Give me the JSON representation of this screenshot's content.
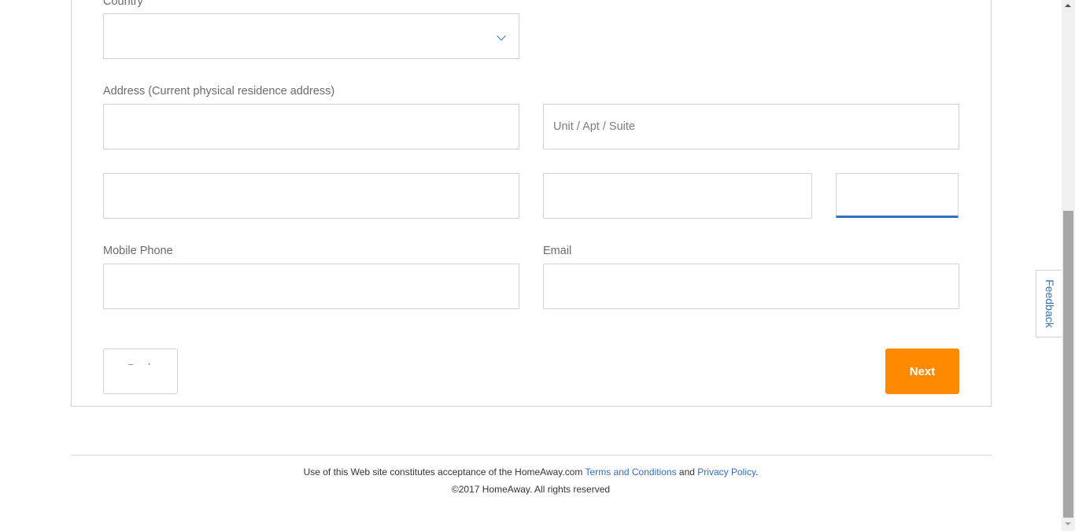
{
  "form": {
    "country": {
      "label": "Country",
      "selected_value": ""
    },
    "address": {
      "label": "Address (Current physical residence address)",
      "street_value": "",
      "unit_placeholder": "Unit / Apt / Suite",
      "unit_value": "",
      "city_value": "",
      "state_value": "",
      "postal_code_value": ""
    },
    "mobile_phone": {
      "label": "Mobile Phone",
      "value": ""
    },
    "email": {
      "label": "Email",
      "value": ""
    },
    "buttons": {
      "back_label": "Back",
      "next_label": "Next"
    },
    "colors": {
      "accent_blue": "#2f6fbf",
      "next_orange": "#ff8a00"
    }
  },
  "footer": {
    "prefix_text": "Use of this Web site constitutes acceptance of the HomeAway.com ",
    "terms_link": "Terms and Conditions",
    "middle_text": " and ",
    "privacy_link": "Privacy Policy",
    "suffix_text": ".",
    "copyright": "©2017 HomeAway. All rights reserved"
  },
  "feedback_tab": {
    "label": "Feedback"
  }
}
